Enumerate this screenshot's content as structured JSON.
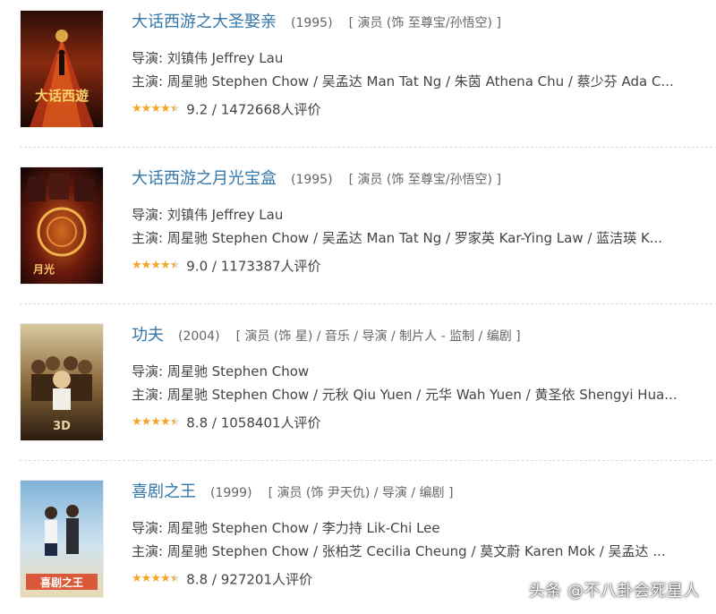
{
  "colors": {
    "title_link": "#3377aa",
    "star": "#f5a623",
    "text": "#444444",
    "muted": "#666666"
  },
  "movies": [
    {
      "title": "大话西游之大圣娶亲",
      "year": "(1995)",
      "roles": "[ 演员 (饰 至尊宝/孙悟空) ]",
      "director": "导演: 刘镇伟 Jeffrey Lau",
      "cast": "主演: 周星驰 Stephen Chow / 吴孟达 Man Tat Ng / 朱茵 Athena Chu / 蔡少芬 Ada C...",
      "stars": 4.5,
      "rating": "9.2 / 1472668人评价",
      "poster_icon": "movie-poster"
    },
    {
      "title": "大话西游之月光宝盒",
      "year": "(1995)",
      "roles": "[ 演员 (饰 至尊宝/孙悟空) ]",
      "director": "导演: 刘镇伟 Jeffrey Lau",
      "cast": "主演: 周星驰 Stephen Chow / 吴孟达 Man Tat Ng / 罗家英 Kar-Ying Law / 蓝洁瑛 K...",
      "stars": 4.5,
      "rating": "9.0 / 1173387人评价",
      "poster_icon": "movie-poster"
    },
    {
      "title": "功夫",
      "year": "(2004)",
      "roles": "[ 演员 (饰 星) / 音乐 / 导演 / 制片人 - 监制 / 编剧 ]",
      "director": "导演: 周星驰 Stephen Chow",
      "cast": "主演: 周星驰 Stephen Chow / 元秋 Qiu Yuen / 元华 Wah Yuen / 黄圣依 Shengyi Hua...",
      "stars": 4.5,
      "rating": "8.8 / 1058401人评价",
      "poster_icon": "movie-poster"
    },
    {
      "title": "喜剧之王",
      "year": "(1999)",
      "roles": "[ 演员 (饰 尹天仇) / 导演 / 编剧 ]",
      "director": "导演: 周星驰 Stephen Chow / 李力持 Lik-Chi Lee",
      "cast": "主演: 周星驰 Stephen Chow / 张柏芝 Cecilia Cheung / 莫文蔚 Karen Mok / 吴孟达 ...",
      "stars": 4.5,
      "rating": "8.8 / 927201人评价",
      "poster_icon": "movie-poster"
    }
  ],
  "watermark": "头条 @不八卦会死星人"
}
